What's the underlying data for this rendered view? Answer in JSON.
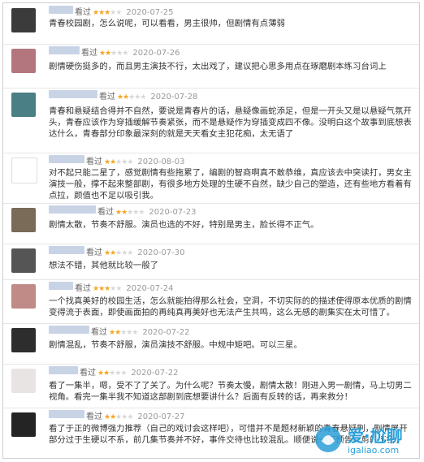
{
  "star_full": "★",
  "star_empty": "★",
  "reviews": [
    {
      "action": "看过",
      "stars": 3,
      "date": "2020-07-25",
      "avatar_color": "#3b3b3b",
      "text": "青春校园剧，怎么说呢，可以看看，男主很帅，但剧情有点薄弱"
    },
    {
      "action": "看过",
      "stars": 2,
      "date": "2020-07-26",
      "avatar_color": "#b4767e",
      "text": "剧情硬伤挺多的，而且男主演技不行，太出戏了，建议把心思多用点在琢磨剧本练习台词上"
    },
    {
      "action": "看过",
      "stars": 2,
      "date": "2020-07-28",
      "avatar_color": "#4a7f86",
      "text": "青春和悬疑结合得并不自然，要说是青春片的话，悬疑像画蛇添足，但是一开头又是以悬疑气氛开头，青春应该作为穿插缓解节奏紧张，而不是悬疑作为穿插变成四不像。没明白这个故事到底想表达什么，青春部分印象最深刻的就是天天看女主犯花痴，太无语了"
    },
    {
      "action": "看过",
      "stars": 2,
      "date": "2020-08-03",
      "avatar_color": "#ffffff",
      "text": "对不起只能二星了，感觉剧情有些拖累了，编剧的智商啊真不敢恭维，真应该去中突读打，男女主演技一般，撑不起来整部剧，有很多地方处理的生硬不自然，缺少自己的塑造，还有些地方看着有点拉，颜值也不足以吸引我。"
    },
    {
      "action": "看过",
      "stars": 2,
      "date": "2020-07-23",
      "avatar_color": "#7a6a58",
      "text": "剧情太散，节奏不舒服。演员也选的不好，特别是男主，脸长得不正气。"
    },
    {
      "action": "看过",
      "stars": 2,
      "date": "2020-07-30",
      "avatar_color": "#555555",
      "text": "想法不错，其他就比较一般了"
    },
    {
      "action": "看过",
      "stars": 3,
      "date": "2020-07-24",
      "avatar_color": "#c08a86",
      "text": "一个找真美好的校园生活，怎么就能拍得那么社会，空洞，不切实际的的描述使得原本优质的剧情变得流于表面，即使画面拍的再纯真再美好也无法产生共鸣，这么无感的剧集实在太可惜了。"
    },
    {
      "action": "看过",
      "stars": 2,
      "date": "2020-07-22",
      "avatar_color": "#2d2d2d",
      "text": "剧情混乱，节奏不舒服，演员演技不舒服。中规中矩吧。可以三星。"
    },
    {
      "action": "看过",
      "stars": 2,
      "date": "2020-07-22",
      "avatar_color": "#e9e4e4",
      "text": "看了一集半，嗯，受不了了关了。为什么呢？节奏太慢，剧情太散！刚进入男一剧情，马上切男二视角。看完一集半我不知道这部剧到底想要讲什么？后面有反转的话，再来救分！"
    },
    {
      "action": "看过",
      "stars": 2,
      "date": "2020-07-27",
      "avatar_color": "#242424",
      "text": "看了于正的微博强力推荐（自己的戏讨会这样吧），可惜并不是题材新颖的青春悬疑剧，剧情展开部分过于生硬以不系，前几集节奏并不好，事件交待也比较混乱。顺便说一下预告片剪的不错。"
    }
  ],
  "watermark": {
    "title": "爱·尬聊",
    "url": "igaliao.com",
    "logo_color": "#2a9fd8"
  }
}
